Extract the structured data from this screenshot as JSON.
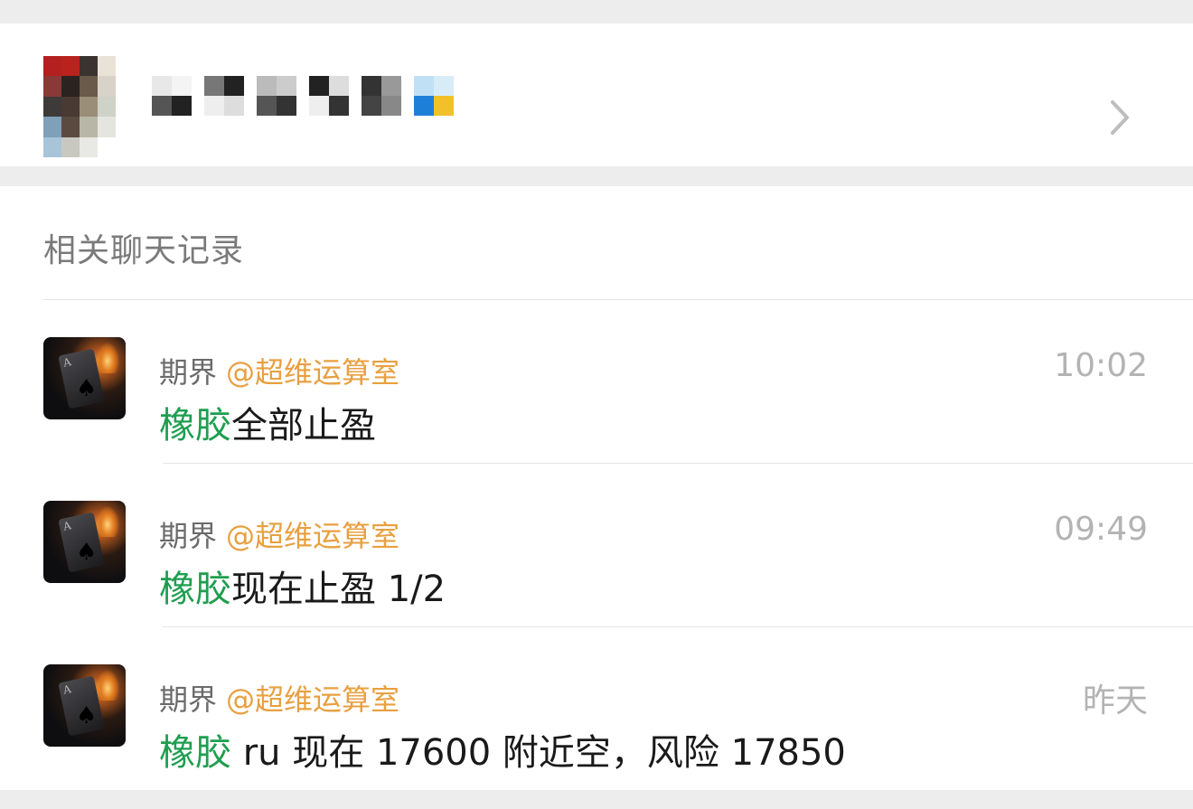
{
  "group": {
    "name_redacted": true
  },
  "related": {
    "title": "相关聊天记录"
  },
  "messages": [
    {
      "sender": "期界",
      "mention": "@超维运算室",
      "time": "10:02",
      "keyword": "橡胶",
      "text": "全部止盈"
    },
    {
      "sender": "期界",
      "mention": "@超维运算室",
      "time": "09:49",
      "keyword": "橡胶",
      "text": "现在止盈 1/2"
    },
    {
      "sender": "期界",
      "mention": "@超维运算室",
      "time": "昨天",
      "keyword": "橡胶",
      "text": " ru 现在 17600 附近空，风险 17850"
    }
  ],
  "colors": {
    "keyword": "#1f9e4f",
    "mention": "#e8a040",
    "background": "#ededed"
  },
  "icons": {
    "chevron": "chevron-right-icon"
  }
}
